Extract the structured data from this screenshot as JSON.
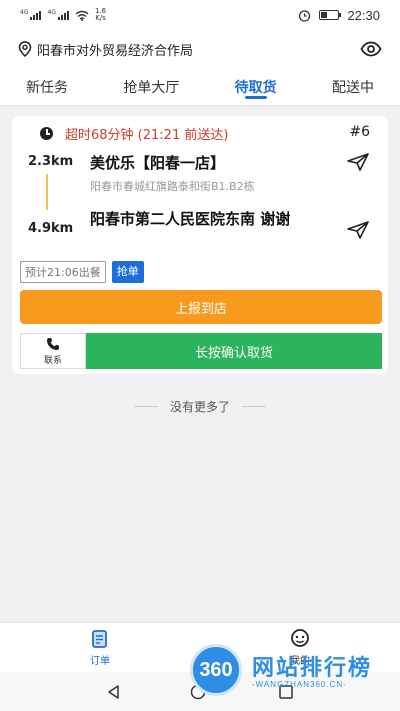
{
  "status_bar": {
    "sim1_label": "4G",
    "sim2_label": "4G",
    "speed_value": "1.6",
    "speed_unit": "K/s",
    "time": "22:30"
  },
  "header": {
    "location": "阳春市对外贸易经济合作局"
  },
  "tabs": [
    {
      "label": "新任务"
    },
    {
      "label": "抢单大厅"
    },
    {
      "label": "待取货"
    },
    {
      "label": "配送中"
    }
  ],
  "active_tab": "待取货",
  "order": {
    "overtime_text": "超时68分钟 (21:21 前送达)",
    "order_number": "#6",
    "pickup_distance": "2.3km",
    "store_name": "美优乐【阳春一店】",
    "store_address": "阳春市春城红旗路泰和街B1.B2栋",
    "dropoff_distance": "4.9km",
    "dropoff_name": "阳春市第二人民医院东南 谢谢",
    "estimate_tag": "预计21:06出餐",
    "grab_tag": "抢单",
    "report_button": "上报到店",
    "contact_label": "联系",
    "confirm_button": "长按确认取货"
  },
  "list_end_text": "没有更多了",
  "bottom_nav": {
    "orders_label": "订单",
    "me_label": "我的"
  },
  "watermark": {
    "logo_text": "360",
    "title": "网站排行榜",
    "subtitle": "-WANGZHAN360.CN-"
  },
  "colors": {
    "accent_blue": "#1e6fd9",
    "overtime_red": "#d43b2a",
    "report_orange": "#f79a1d",
    "confirm_green": "#2bb45c"
  }
}
